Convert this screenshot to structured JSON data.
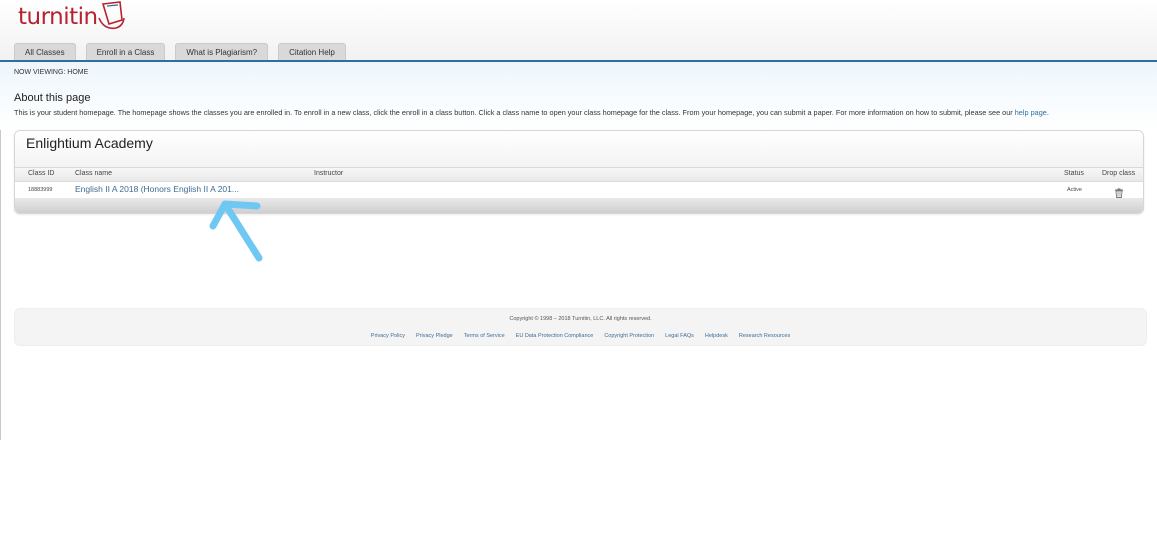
{
  "header": {
    "logo_text": "turnitin",
    "logo_color": "#b5232f",
    "tabs": [
      {
        "label": "All Classes"
      },
      {
        "label": "Enroll in a Class"
      },
      {
        "label": "What is Plagiarism?"
      },
      {
        "label": "Citation Help"
      }
    ],
    "accent_color": "#2e6f9e"
  },
  "breadcrumb": "NOW VIEWING: HOME",
  "about": {
    "title": "About this page",
    "description": "This is your student homepage. The homepage shows the classes you are enrolled in. To enroll in a new class, click the enroll in a class button. Click a class name to open your class homepage for the class. From your homepage, you can submit a paper. For more information on how to submit, please see our ",
    "help_link": "help page",
    "trailing": "."
  },
  "institution": {
    "name": "Enlightium Academy",
    "columns": {
      "class_id": "Class ID",
      "class_name": "Class name",
      "instructor": "Instructor",
      "status": "Status",
      "drop": "Drop class"
    },
    "rows": [
      {
        "class_id": "18883999",
        "class_name": "English II A 2018 (Honors English II A 201...",
        "instructor": "",
        "status": "Active",
        "drop_icon": "trash-icon"
      }
    ]
  },
  "annotation": {
    "type": "arrow",
    "color": "#6ec8f2"
  },
  "footer": {
    "copyright": "Copyright © 1998 – 2018 Turnitin, LLC. All rights reserved.",
    "links": [
      {
        "label": "Privacy Policy"
      },
      {
        "label": "Privacy Pledge"
      },
      {
        "label": "Terms of Service"
      },
      {
        "label": "EU Data Protection Compliance"
      },
      {
        "label": "Copyright Protection"
      },
      {
        "label": "Legal FAQs"
      },
      {
        "label": "Helpdesk"
      },
      {
        "label": "Research Resources"
      }
    ]
  }
}
